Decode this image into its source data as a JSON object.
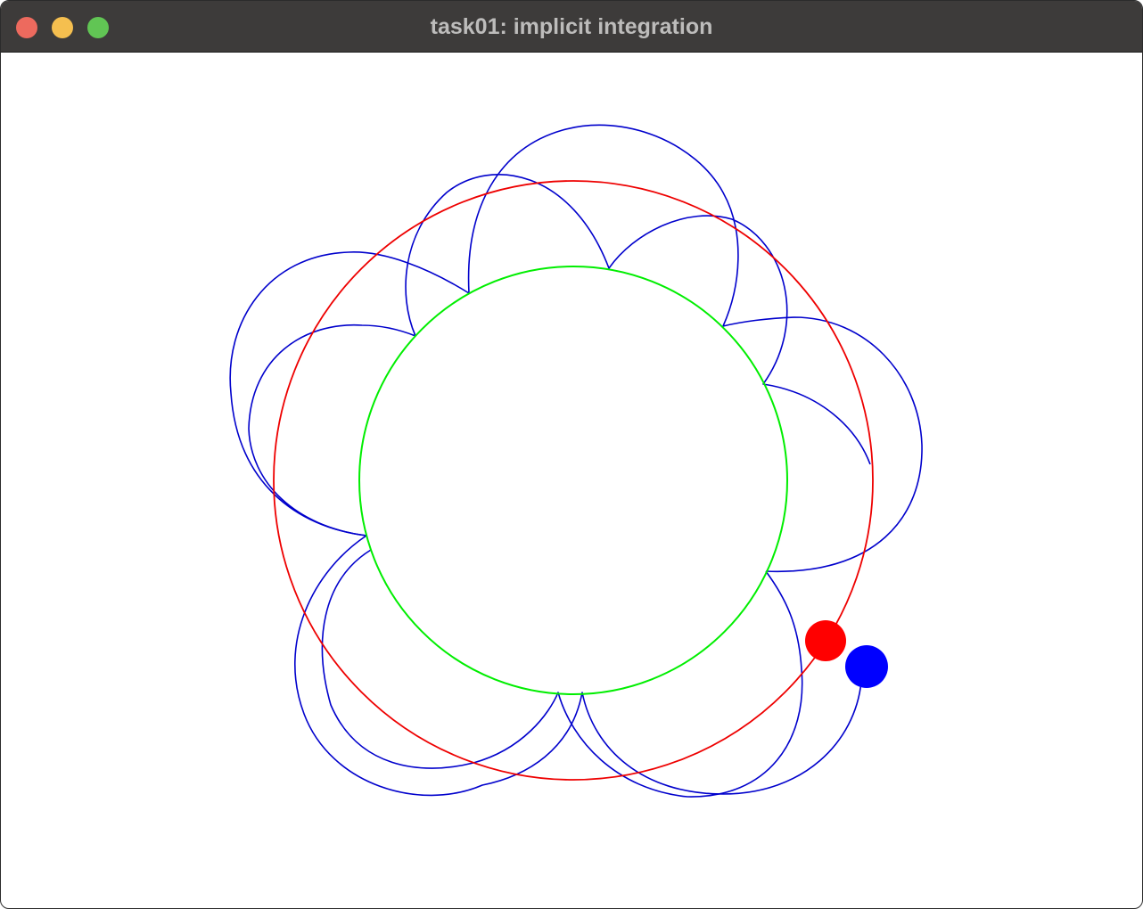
{
  "window": {
    "title": "task01: implicit integration"
  },
  "scene": {
    "colors": {
      "inner_circle": "#00ee00",
      "outer_circle": "#ee0000",
      "trajectory": "#0000cc",
      "red_particle": "#ff0000",
      "blue_particle": "#0000ff"
    }
  }
}
